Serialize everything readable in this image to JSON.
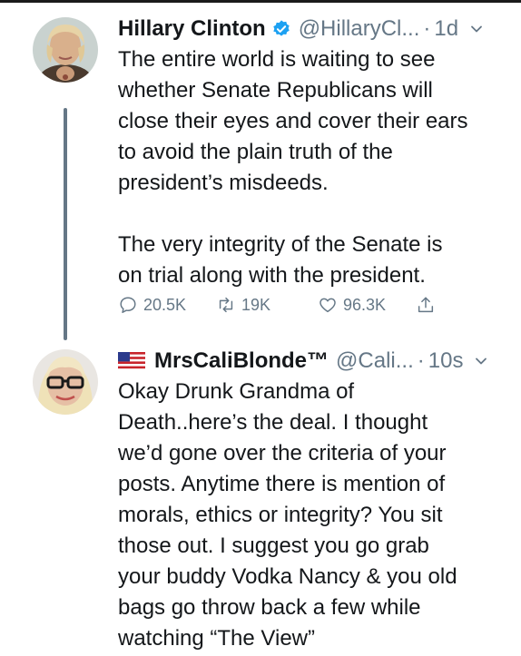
{
  "tweets": [
    {
      "author_name": "Hillary Clinton",
      "handle": "@HillaryCl...",
      "dot": "·",
      "time": "1d",
      "text": "The entire world is waiting to see\nwhether Senate Republicans will\nclose their eyes and cover their ears\nto avoid the plain truth of the\npresident’s misdeeds.\n\nThe very integrity of the Senate is\non trial along with the president.",
      "replies": "20.5K",
      "retweets": "19K",
      "likes": "96.3K",
      "verified": true
    },
    {
      "author_name": "MrsCaliBlonde™",
      "handle": "@Cali...",
      "dot": "·",
      "time": "10s",
      "text": "Okay Drunk Grandma of\nDeath..here’s the deal. I thought\nwe’d gone over the criteria of your\nposts. Anytime there is mention of\nmorals, ethics or integrity? You sit\nthose out. I suggest you go grab\nyour buddy Vodka Nancy & you old\nbags go throw back a few while\nwatching “The View”",
      "flag_icon": "us-flag-icon"
    }
  ],
  "colors": {
    "text": "#14171a",
    "secondary": "#657786",
    "verified_blue": "#1da1f2",
    "thread_line": "#657786"
  },
  "icons": [
    "verified-badge-icon",
    "chevron-down-icon",
    "reply-icon",
    "retweet-icon",
    "like-icon",
    "share-icon",
    "us-flag-icon"
  ]
}
